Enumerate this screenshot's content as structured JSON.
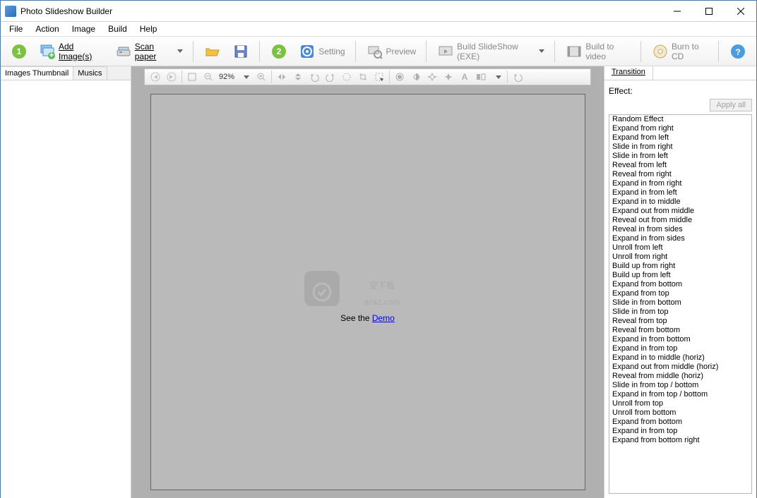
{
  "title": "Photo Slideshow Builder",
  "menu": [
    "File",
    "Action",
    "Image",
    "Build",
    "Help"
  ],
  "toolbar": {
    "add_images": "Add Image(s)",
    "scan_paper": "Scan paper",
    "setting": "Setting",
    "preview": "Preview",
    "build_slideshow": "Build SlideShow (EXE)",
    "build_video": "Build to video",
    "burn_cd": "Burn to CD"
  },
  "left_tabs": {
    "thumbnail": "Images Thumbnail",
    "musics": "Musics"
  },
  "center": {
    "zoom": "92%",
    "see_the": "See the ",
    "demo": "Demo",
    "watermark": "安下载 anxz.com"
  },
  "right": {
    "tab": "Transition",
    "effect_label": "Effect:",
    "apply_all": "Apply all",
    "effects": [
      "Random Effect",
      "Expand from right",
      "Expand from left",
      "Slide in from right",
      "Slide in from left",
      "Reveal from left",
      "Reveal from right",
      "Expand in from right",
      "Expand in from left",
      "Expand in to middle",
      "Expand out from middle",
      "Reveal out from middle",
      "Reveal in from sides",
      "Expand in from sides",
      "Unroll from left",
      "Unroll from right",
      "Build up from right",
      "Build up from left",
      "Expand from bottom",
      "Expand from top",
      "Slide in from bottom",
      "Slide in from top",
      "Reveal from top",
      "Reveal from bottom",
      "Expand in from bottom",
      "Expand in from top",
      "Expand in to middle (horiz)",
      "Expand out from middle (horiz)",
      "Reveal from middle (horiz)",
      "Slide in from top / bottom",
      "Expand in from top / bottom",
      "Unroll from top",
      "Unroll from bottom",
      "Expand from bottom",
      "Expand in from top",
      "Expand from bottom right"
    ]
  }
}
